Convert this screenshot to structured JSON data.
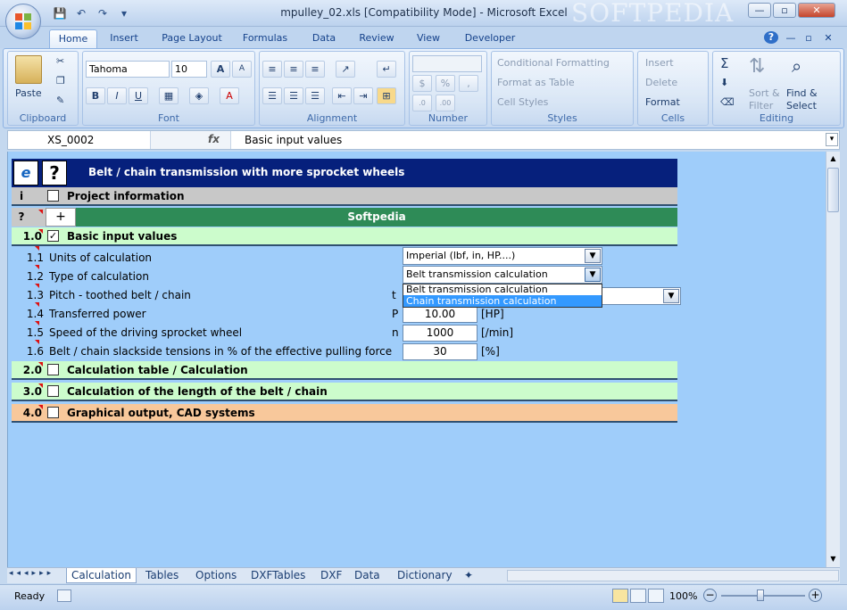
{
  "window": {
    "title": "mpulley_02.xls  [Compatibility Mode] - Microsoft Excel",
    "watermark": "SOFTPEDIA",
    "controls": [
      "—",
      "▫",
      "✕"
    ]
  },
  "qat": {
    "save": "💾",
    "undo": "↶",
    "redo": "↷",
    "customize": "▾"
  },
  "ribbon_tabs": [
    "Home",
    "Insert",
    "Page Layout",
    "Formulas",
    "Data",
    "Review",
    "View",
    "Developer"
  ],
  "ribbon_right": {
    "help": "?",
    "min": "—",
    "restore": "▫",
    "close": "✕"
  },
  "ribbon": {
    "clipboard": {
      "label": "Clipboard",
      "paste": "Paste"
    },
    "font": {
      "label": "Font",
      "name": "Tahoma",
      "size": "10",
      "grow": "A",
      "shrink": "A",
      "bold": "B",
      "italic": "I",
      "underline": "U"
    },
    "alignment": {
      "label": "Alignment"
    },
    "number": {
      "label": "Number",
      "currency": "$",
      "percent": "%",
      "comma": ","
    },
    "styles": {
      "label": "Styles",
      "conditional": "Conditional Formatting",
      "table": "Format as Table",
      "cell": "Cell Styles"
    },
    "cells": {
      "label": "Cells",
      "insert": "Insert",
      "delete": "Delete",
      "format": "Format"
    },
    "editing": {
      "label": "Editing",
      "sigma": "Σ",
      "sort": "Sort &",
      "filter": "Filter",
      "find": "Find &",
      "select": "Select"
    }
  },
  "formula_bar": {
    "name_box": "XS_0002",
    "fx": "fx",
    "value": "Basic input values"
  },
  "sheet": {
    "title": "Belt / chain transmission with more sprocket wheels",
    "ie_icon": "e",
    "help_icon": "?",
    "project": {
      "num": "i",
      "label": "Project information"
    },
    "brand_row": {
      "num": "?",
      "plus": "+",
      "label": "Softpedia"
    },
    "section1": {
      "num": "1.0",
      "check": "✓",
      "label": "Basic input values"
    },
    "items": [
      {
        "num": "1.1",
        "label": "Units of calculation",
        "sym": "",
        "value": "",
        "unit": ""
      },
      {
        "num": "1.2",
        "label": "Type of calculation",
        "sym": "",
        "value": "",
        "unit": ""
      },
      {
        "num": "1.3",
        "label": "Pitch - toothed belt / chain",
        "sym": "t",
        "value": "",
        "unit": ""
      },
      {
        "num": "1.4",
        "label": "Transferred power",
        "sym": "P",
        "value": "10.00",
        "unit": "[HP]"
      },
      {
        "num": "1.5",
        "label": "Speed of the driving sprocket wheel",
        "sym": "n",
        "value": "1000",
        "unit": "[/min]"
      },
      {
        "num": "1.6",
        "label": "Belt / chain slackside tensions in % of the effective pulling force",
        "sym": "",
        "value": "30",
        "unit": "[%]"
      }
    ],
    "dropdowns": {
      "units": "Imperial (lbf, in, HP....)",
      "type": "Belt transmission calculation",
      "options": [
        "Belt transmission calculation",
        "Chain transmission calculation"
      ]
    },
    "sections": [
      {
        "num": "2.0",
        "label": "Calculation table / Calculation"
      },
      {
        "num": "3.0",
        "label": "Calculation of the length of the belt / chain"
      },
      {
        "num": "4.0",
        "label": "Graphical output, CAD systems"
      }
    ]
  },
  "sheet_tabs": [
    "Calculation",
    "Tables",
    "Options",
    "DXFTables",
    "DXF",
    "Data",
    "Dictionary"
  ],
  "status": {
    "ready": "Ready",
    "zoom": "100%"
  },
  "colors": {
    "accent_green": "#2e8b57",
    "section_green": "#ccfccc",
    "section_orange": "#f8c89b",
    "title_navy": "#06207c",
    "sheet_blue": "#9fcdfa"
  }
}
